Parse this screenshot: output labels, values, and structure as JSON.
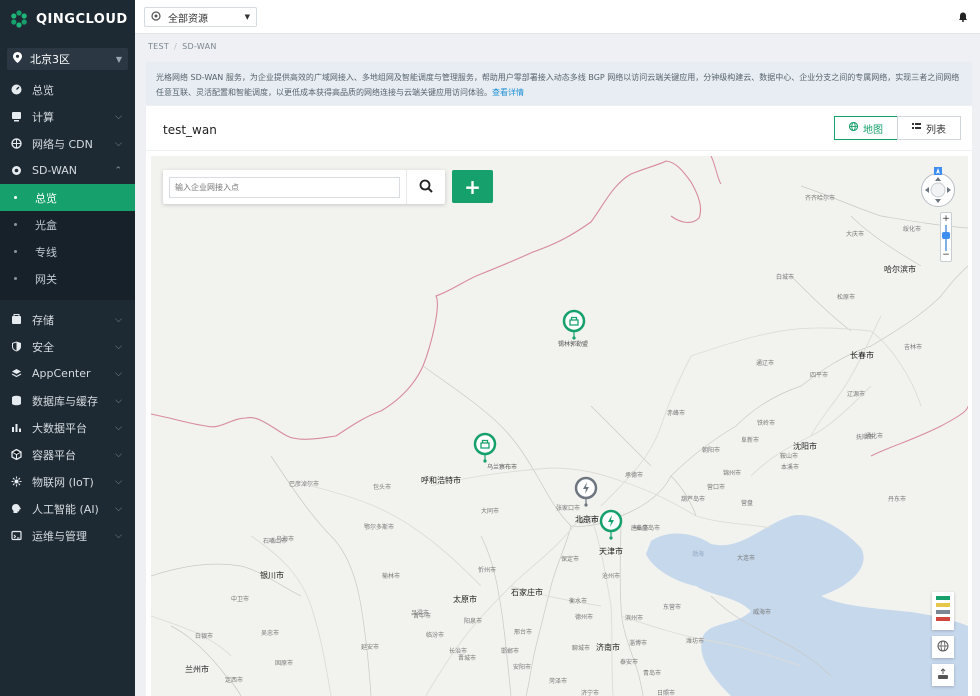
{
  "brand": {
    "name": "QINGCLOUD"
  },
  "region": {
    "label": "北京3区"
  },
  "sidebar": {
    "items": [
      {
        "label": "总览",
        "icon": "dashboard-icon",
        "has_arrow": false
      },
      {
        "label": "计算",
        "icon": "compute-icon",
        "has_arrow": true
      },
      {
        "label": "网络与 CDN",
        "icon": "network-icon",
        "has_arrow": true
      },
      {
        "label": "SD-WAN",
        "icon": "sdwan-icon",
        "has_arrow": true,
        "expanded": true,
        "children": [
          {
            "label": "总览",
            "active": true
          },
          {
            "label": "光盒",
            "active": false
          },
          {
            "label": "专线",
            "active": false
          },
          {
            "label": "网关",
            "active": false
          }
        ]
      },
      {
        "label": "存储",
        "icon": "storage-icon",
        "has_arrow": true
      },
      {
        "label": "安全",
        "icon": "security-icon",
        "has_arrow": true
      },
      {
        "label": "AppCenter",
        "icon": "appcenter-icon",
        "has_arrow": true
      },
      {
        "label": "数据库与缓存",
        "icon": "database-icon",
        "has_arrow": true
      },
      {
        "label": "大数据平台",
        "icon": "bigdata-icon",
        "has_arrow": true
      },
      {
        "label": "容器平台",
        "icon": "container-icon",
        "has_arrow": true
      },
      {
        "label": "物联网 (IoT)",
        "icon": "iot-icon",
        "has_arrow": true
      },
      {
        "label": "人工智能 (AI)",
        "icon": "ai-icon",
        "has_arrow": true
      },
      {
        "label": "运维与管理",
        "icon": "ops-icon",
        "has_arrow": true
      }
    ]
  },
  "topbar": {
    "resource_select": "全部资源"
  },
  "breadcrumb": {
    "root": "TEST",
    "sep": "/",
    "current": "SD-WAN"
  },
  "intro": {
    "text": "光格网络 SD-WAN 服务，为企业提供高效的广域网接入、多地组网及智能调度与管理服务，帮助用户零部署接入动态多线 BGP 网络以访问云端关键应用，分钟级构建云、数据中心、企业分支之间的专属网络，实现三者之间网络任意互联、灵活配置和智能调度，以更低成本获得高品质的网络连接与云端关键应用访问体验。",
    "link": "查看详情"
  },
  "panel": {
    "title": "test_wan",
    "view_map": "地图",
    "view_list": "列表"
  },
  "map": {
    "search_placeholder": "输入企业网接入点",
    "add_label": "+",
    "sea_label": "渤海",
    "markers": [
      {
        "label": "锡林郭勒盟",
        "status": "green"
      },
      {
        "label": "乌兰察布市",
        "status": "green"
      },
      {
        "label": "北京市",
        "status": "gray"
      },
      {
        "label": "天津市",
        "status": "green"
      }
    ],
    "legend_colors": [
      "#16a06b",
      "#e5c84a",
      "#f0a040",
      "#7b8793",
      "#d0473d"
    ],
    "cities": [
      "齐齐哈尔市",
      "大庆市",
      "绥化市",
      "哈尔滨市",
      "白城市",
      "松原市",
      "长春市",
      "吉林市",
      "通辽市",
      "四平市",
      "辽源市",
      "赤峰市",
      "铁岭市",
      "沈阳市",
      "朝阳市",
      "阜新市",
      "抚顺市",
      "通化市",
      "本溪市",
      "锦州市",
      "鞍山市",
      "营口市",
      "葫芦岛市",
      "丹东市",
      "大连市",
      "威海市",
      "承德市",
      "秦皇岛市",
      "唐山市",
      "呼和浩特市",
      "包头市",
      "巴彦淖尔市",
      "鄂尔多斯市",
      "大同市",
      "张家口市",
      "廊坊市",
      "沧州市",
      "保定市",
      "石家庄市",
      "忻州市",
      "榆林市",
      "太原市",
      "吕梁市",
      "衡水市",
      "德州市",
      "滨州市",
      "东营市",
      "潍坊市",
      "青岛市",
      "济南市",
      "淄博市",
      "邢台市",
      "邯郸市",
      "长治市",
      "晋中市",
      "阳泉市",
      "聊城市",
      "泰安市",
      "安阳市",
      "乌海市",
      "石嘴山市",
      "银川市",
      "中卫市",
      "吴忠市",
      "固原市",
      "白银市",
      "兰州市",
      "定西市",
      "延安市",
      "晋城市",
      "临汾市",
      "济宁市",
      "菏泽市",
      "日照市",
      "营盘"
    ]
  }
}
